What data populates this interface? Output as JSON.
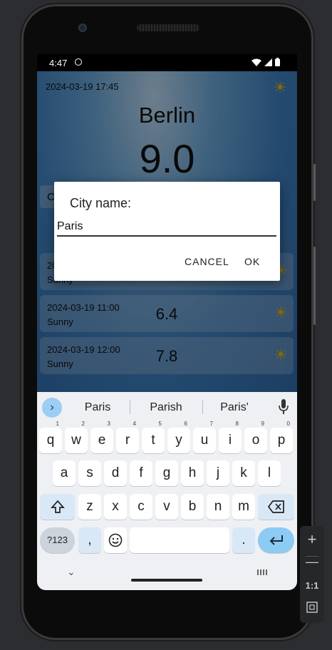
{
  "status_bar": {
    "time": "4:47"
  },
  "app": {
    "header_date": "2024-03-19 17:45",
    "city": "Berlin",
    "temperature": "9.0",
    "cards": [
      {
        "date": "20",
        "description": "Sunny",
        "temperature": ""
      },
      {
        "date": "2024-03-19 11:00",
        "description": "Sunny",
        "temperature": "6.4"
      },
      {
        "date": "2024-03-19 12:00",
        "description": "Sunny",
        "temperature": "7.8"
      }
    ],
    "side_letter": "C"
  },
  "dialog": {
    "title": "City name:",
    "input_value": "Paris",
    "cancel_label": "CANCEL",
    "ok_label": "OK"
  },
  "keyboard": {
    "suggestions": [
      "Paris",
      "Parish",
      "Paris'"
    ],
    "row1": [
      "q",
      "w",
      "e",
      "r",
      "t",
      "y",
      "u",
      "i",
      "o",
      "p"
    ],
    "row1_hints": [
      "1",
      "2",
      "3",
      "4",
      "5",
      "6",
      "7",
      "8",
      "9",
      "0"
    ],
    "row2": [
      "a",
      "s",
      "d",
      "f",
      "g",
      "h",
      "j",
      "k",
      "l"
    ],
    "row3": [
      "z",
      "x",
      "c",
      "v",
      "b",
      "n",
      "m"
    ],
    "symbols_label": "?123",
    "comma": ",",
    "period": "."
  },
  "emulator_panel": {
    "zoom_label": "1:1"
  },
  "colors": {
    "accent_blue": "#8ccbf3",
    "sun_yellow": "#e8b200"
  }
}
